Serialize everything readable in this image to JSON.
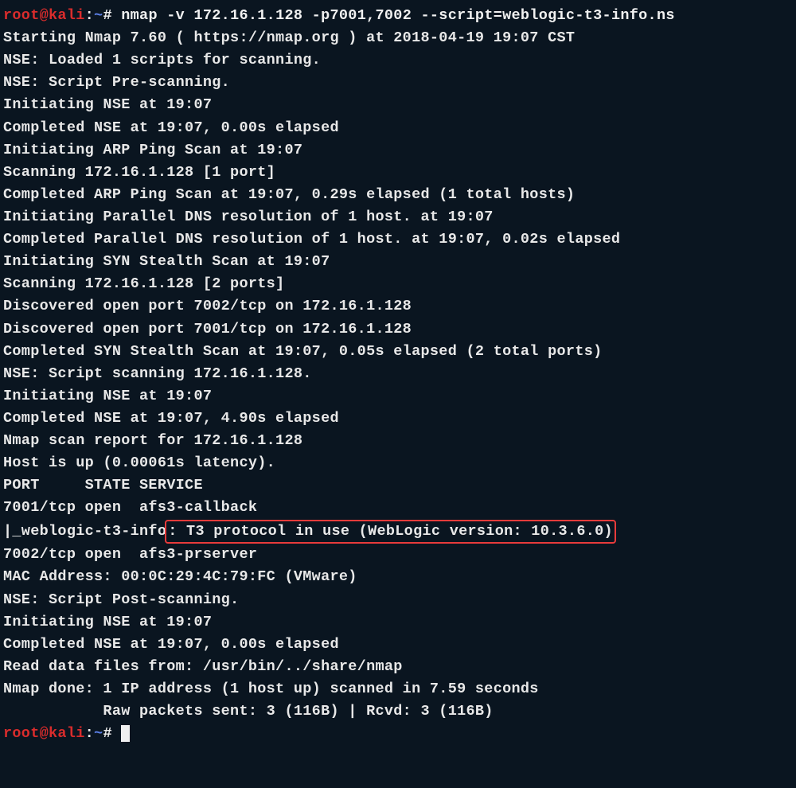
{
  "prompt": {
    "user": "root@kali",
    "sep1": ":",
    "path": "~",
    "sep2": "#",
    "command": " nmap -v 172.16.1.128 -p7001,7002 --script=weblogic-t3-info.ns"
  },
  "lines": {
    "l01": "",
    "l02": "Starting Nmap 7.60 ( https://nmap.org ) at 2018-04-19 19:07 CST",
    "l03": "NSE: Loaded 1 scripts for scanning.",
    "l04": "NSE: Script Pre-scanning.",
    "l05": "Initiating NSE at 19:07",
    "l06": "Completed NSE at 19:07, 0.00s elapsed",
    "l07": "Initiating ARP Ping Scan at 19:07",
    "l08": "Scanning 172.16.1.128 [1 port]",
    "l09": "Completed ARP Ping Scan at 19:07, 0.29s elapsed (1 total hosts)",
    "l10": "Initiating Parallel DNS resolution of 1 host. at 19:07",
    "l11": "Completed Parallel DNS resolution of 1 host. at 19:07, 0.02s elapsed",
    "l12": "Initiating SYN Stealth Scan at 19:07",
    "l13": "Scanning 172.16.1.128 [2 ports]",
    "l14": "Discovered open port 7002/tcp on 172.16.1.128",
    "l15": "Discovered open port 7001/tcp on 172.16.1.128",
    "l16": "Completed SYN Stealth Scan at 19:07, 0.05s elapsed (2 total ports)",
    "l17": "NSE: Script scanning 172.16.1.128.",
    "l18": "Initiating NSE at 19:07",
    "l19": "Completed NSE at 19:07, 4.90s elapsed",
    "l20": "Nmap scan report for 172.16.1.128",
    "l21": "Host is up (0.00061s latency).",
    "l22": "",
    "l23": "PORT     STATE SERVICE",
    "l24": "7001/tcp open  afs3-callback",
    "l25a": "|_weblogic-t3-info",
    "l25b": ": T3 protocol in use (WebLogic version: 10.3.6.0)",
    "l26": "7002/tcp open  afs3-prserver",
    "l27": "MAC Address: 00:0C:29:4C:79:FC (VMware)",
    "l28": "",
    "l29": "NSE: Script Post-scanning.",
    "l30": "Initiating NSE at 19:07",
    "l31": "Completed NSE at 19:07, 0.00s elapsed",
    "l32": "Read data files from: /usr/bin/../share/nmap",
    "l33": "Nmap done: 1 IP address (1 host up) scanned in 7.59 seconds",
    "l34": "           Raw packets sent: 3 (116B) | Rcvd: 3 (116B)"
  },
  "prompt2": {
    "user": "root@kali",
    "sep1": ":",
    "path": "~",
    "sep2": "#",
    "space": " "
  }
}
